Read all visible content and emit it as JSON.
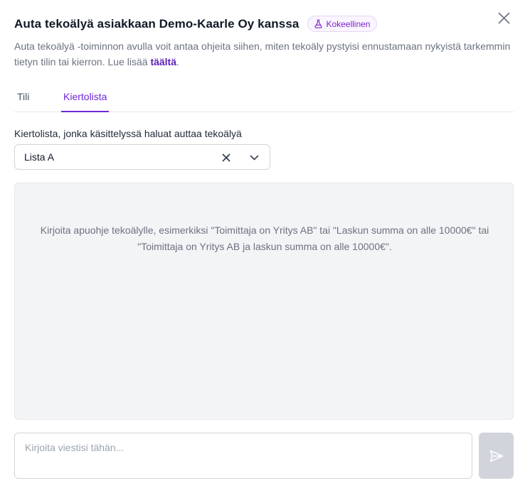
{
  "dialog": {
    "title": "Auta tekoälyä asiakkaan Demo-Kaarle Oy kanssa",
    "badge": "Kokeellinen",
    "description_text": "Auta tekoälyä -toiminnon avulla voit antaa ohjeita siihen, miten tekoäly pystyisi ennustamaan nykyistä tarkemmin tietyn tilin tai kierron. Lue lisää ",
    "description_link": "täältä",
    "description_end": "."
  },
  "tabs": [
    {
      "label": "Tili",
      "active": false
    },
    {
      "label": "Kiertolista",
      "active": true
    }
  ],
  "field": {
    "label": "Kiertolista, jonka käsittelyssä haluat auttaa tekoälyä",
    "value": "Lista A"
  },
  "chat": {
    "hint": "Kirjoita apuohje tekoälylle, esimerkiksi \"Toimittaja on Yritys AB\" tai \"Laskun summa on alle 10000€\" tai \"Toimittaja on Yritys AB ja laskun summa on alle 10000€\"."
  },
  "composer": {
    "placeholder": "Kirjoita viestisi tähän..."
  },
  "icons": {
    "badge": "flask-icon",
    "close": "close-icon",
    "clear": "clear-icon",
    "dropdown": "chevron-down-icon",
    "send": "send-icon"
  },
  "colors": {
    "accent": "#6d28d9",
    "badge_bg": "#faf5ff",
    "badge_text": "#7e22ce",
    "send_disabled": "#d1d5db"
  }
}
